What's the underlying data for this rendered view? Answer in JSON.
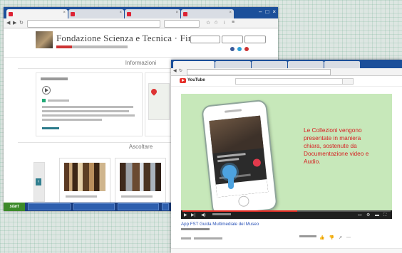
{
  "back_window": {
    "tabs": [
      {
        "label": "",
        "active": true
      },
      {
        "label": "",
        "active": false
      },
      {
        "label": "",
        "active": false
      },
      {
        "label": "",
        "active": false
      }
    ],
    "url": "",
    "site": {
      "title": "Fondazione Scienza e Tecnica · Firenze",
      "section_info": "Informazioni",
      "section_gallery": "Ascoltare"
    },
    "taskbar": {
      "start_label": "start"
    }
  },
  "front_window": {
    "url": "",
    "brand": "YouTube",
    "video": {
      "caption": "Le Collezioni vengono\npresentate in maniera\nchiara, sostenute da\nDocumentazione video e\nAudio.",
      "progress": 0.55,
      "title": "App FST Guida Multimediale del Museo"
    }
  },
  "colors": {
    "accent": "#e52d27",
    "caption": "#d62022",
    "video_bg": "#c7e8ba",
    "tabbar": "#1b4f9a"
  },
  "icons": [
    "close-icon",
    "back-icon",
    "forward-icon",
    "reload-icon",
    "home-icon",
    "play-icon",
    "volume-icon",
    "settings-icon",
    "fullscreen-icon",
    "like-icon",
    "share-icon",
    "map-pin-icon"
  ]
}
